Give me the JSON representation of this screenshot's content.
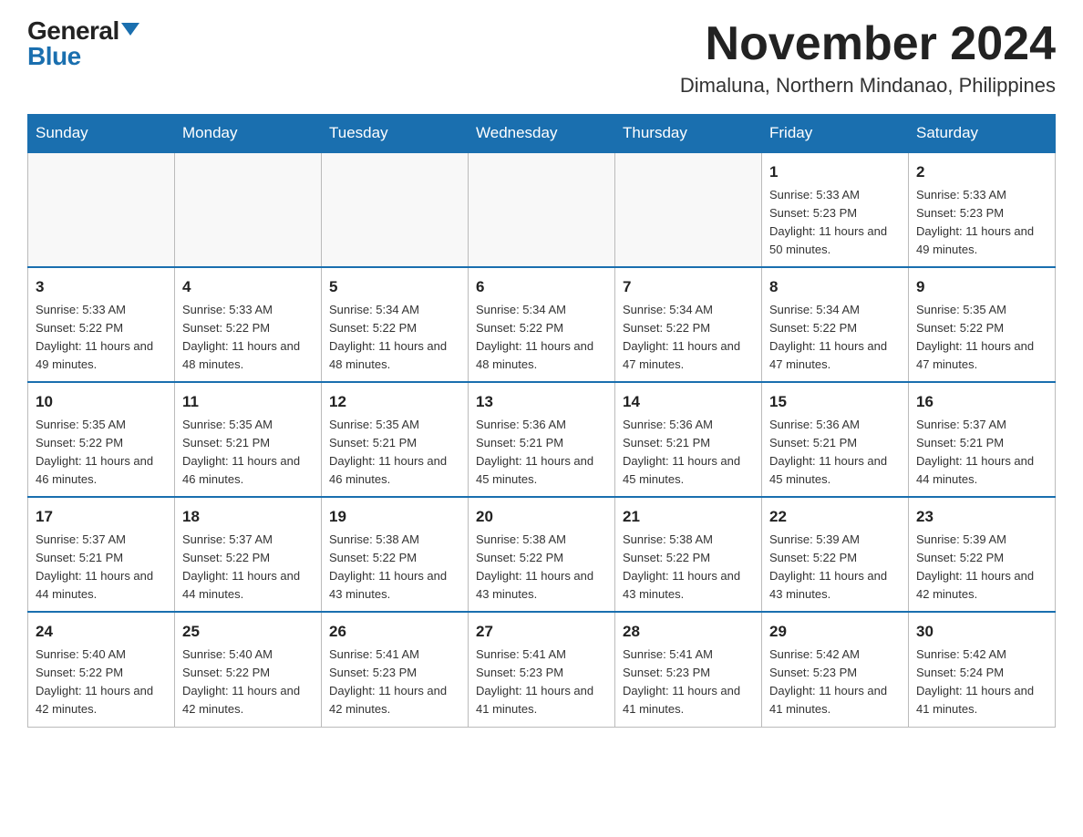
{
  "logo": {
    "general": "General",
    "blue": "Blue"
  },
  "title": "November 2024",
  "location": "Dimaluna, Northern Mindanao, Philippines",
  "days_of_week": [
    "Sunday",
    "Monday",
    "Tuesday",
    "Wednesday",
    "Thursday",
    "Friday",
    "Saturday"
  ],
  "weeks": [
    [
      {
        "day": "",
        "info": ""
      },
      {
        "day": "",
        "info": ""
      },
      {
        "day": "",
        "info": ""
      },
      {
        "day": "",
        "info": ""
      },
      {
        "day": "",
        "info": ""
      },
      {
        "day": "1",
        "info": "Sunrise: 5:33 AM\nSunset: 5:23 PM\nDaylight: 11 hours and 50 minutes."
      },
      {
        "day": "2",
        "info": "Sunrise: 5:33 AM\nSunset: 5:23 PM\nDaylight: 11 hours and 49 minutes."
      }
    ],
    [
      {
        "day": "3",
        "info": "Sunrise: 5:33 AM\nSunset: 5:22 PM\nDaylight: 11 hours and 49 minutes."
      },
      {
        "day": "4",
        "info": "Sunrise: 5:33 AM\nSunset: 5:22 PM\nDaylight: 11 hours and 48 minutes."
      },
      {
        "day": "5",
        "info": "Sunrise: 5:34 AM\nSunset: 5:22 PM\nDaylight: 11 hours and 48 minutes."
      },
      {
        "day": "6",
        "info": "Sunrise: 5:34 AM\nSunset: 5:22 PM\nDaylight: 11 hours and 48 minutes."
      },
      {
        "day": "7",
        "info": "Sunrise: 5:34 AM\nSunset: 5:22 PM\nDaylight: 11 hours and 47 minutes."
      },
      {
        "day": "8",
        "info": "Sunrise: 5:34 AM\nSunset: 5:22 PM\nDaylight: 11 hours and 47 minutes."
      },
      {
        "day": "9",
        "info": "Sunrise: 5:35 AM\nSunset: 5:22 PM\nDaylight: 11 hours and 47 minutes."
      }
    ],
    [
      {
        "day": "10",
        "info": "Sunrise: 5:35 AM\nSunset: 5:22 PM\nDaylight: 11 hours and 46 minutes."
      },
      {
        "day": "11",
        "info": "Sunrise: 5:35 AM\nSunset: 5:21 PM\nDaylight: 11 hours and 46 minutes."
      },
      {
        "day": "12",
        "info": "Sunrise: 5:35 AM\nSunset: 5:21 PM\nDaylight: 11 hours and 46 minutes."
      },
      {
        "day": "13",
        "info": "Sunrise: 5:36 AM\nSunset: 5:21 PM\nDaylight: 11 hours and 45 minutes."
      },
      {
        "day": "14",
        "info": "Sunrise: 5:36 AM\nSunset: 5:21 PM\nDaylight: 11 hours and 45 minutes."
      },
      {
        "day": "15",
        "info": "Sunrise: 5:36 AM\nSunset: 5:21 PM\nDaylight: 11 hours and 45 minutes."
      },
      {
        "day": "16",
        "info": "Sunrise: 5:37 AM\nSunset: 5:21 PM\nDaylight: 11 hours and 44 minutes."
      }
    ],
    [
      {
        "day": "17",
        "info": "Sunrise: 5:37 AM\nSunset: 5:21 PM\nDaylight: 11 hours and 44 minutes."
      },
      {
        "day": "18",
        "info": "Sunrise: 5:37 AM\nSunset: 5:22 PM\nDaylight: 11 hours and 44 minutes."
      },
      {
        "day": "19",
        "info": "Sunrise: 5:38 AM\nSunset: 5:22 PM\nDaylight: 11 hours and 43 minutes."
      },
      {
        "day": "20",
        "info": "Sunrise: 5:38 AM\nSunset: 5:22 PM\nDaylight: 11 hours and 43 minutes."
      },
      {
        "day": "21",
        "info": "Sunrise: 5:38 AM\nSunset: 5:22 PM\nDaylight: 11 hours and 43 minutes."
      },
      {
        "day": "22",
        "info": "Sunrise: 5:39 AM\nSunset: 5:22 PM\nDaylight: 11 hours and 43 minutes."
      },
      {
        "day": "23",
        "info": "Sunrise: 5:39 AM\nSunset: 5:22 PM\nDaylight: 11 hours and 42 minutes."
      }
    ],
    [
      {
        "day": "24",
        "info": "Sunrise: 5:40 AM\nSunset: 5:22 PM\nDaylight: 11 hours and 42 minutes."
      },
      {
        "day": "25",
        "info": "Sunrise: 5:40 AM\nSunset: 5:22 PM\nDaylight: 11 hours and 42 minutes."
      },
      {
        "day": "26",
        "info": "Sunrise: 5:41 AM\nSunset: 5:23 PM\nDaylight: 11 hours and 42 minutes."
      },
      {
        "day": "27",
        "info": "Sunrise: 5:41 AM\nSunset: 5:23 PM\nDaylight: 11 hours and 41 minutes."
      },
      {
        "day": "28",
        "info": "Sunrise: 5:41 AM\nSunset: 5:23 PM\nDaylight: 11 hours and 41 minutes."
      },
      {
        "day": "29",
        "info": "Sunrise: 5:42 AM\nSunset: 5:23 PM\nDaylight: 11 hours and 41 minutes."
      },
      {
        "day": "30",
        "info": "Sunrise: 5:42 AM\nSunset: 5:24 PM\nDaylight: 11 hours and 41 minutes."
      }
    ]
  ]
}
